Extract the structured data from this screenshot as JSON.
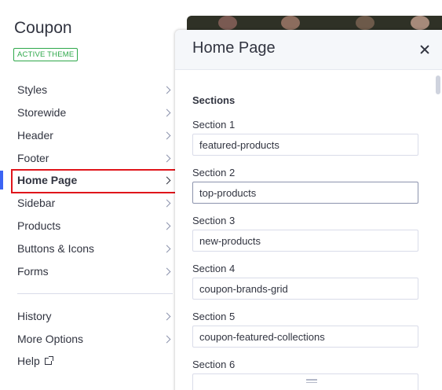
{
  "sidebar": {
    "theme_name": "Coupon",
    "theme_badge": "ACTIVE THEME",
    "items": [
      {
        "label": "Styles"
      },
      {
        "label": "Storewide"
      },
      {
        "label": "Header"
      },
      {
        "label": "Footer"
      },
      {
        "label": "Home Page",
        "active": true
      },
      {
        "label": "Sidebar"
      },
      {
        "label": "Products"
      },
      {
        "label": "Buttons & Icons"
      },
      {
        "label": "Forms"
      }
    ],
    "footer_items": [
      {
        "label": "History"
      },
      {
        "label": "More Options"
      },
      {
        "label": "Help",
        "external": true
      }
    ]
  },
  "panel": {
    "title": "Home Page",
    "close_icon": "close-icon",
    "section_heading": "Sections",
    "fields": [
      {
        "label": "Section 1",
        "value": "featured-products"
      },
      {
        "label": "Section 2",
        "value": "top-products",
        "focused": true
      },
      {
        "label": "Section 3",
        "value": "new-products"
      },
      {
        "label": "Section 4",
        "value": "coupon-brands-grid"
      },
      {
        "label": "Section 5",
        "value": "coupon-featured-collections"
      },
      {
        "label": "Section 6",
        "value": ""
      }
    ]
  },
  "colors": {
    "accent": "#3c64f4",
    "badge_green": "#2ea84a",
    "highlight_red": "#e0151b",
    "text": "#313440"
  }
}
